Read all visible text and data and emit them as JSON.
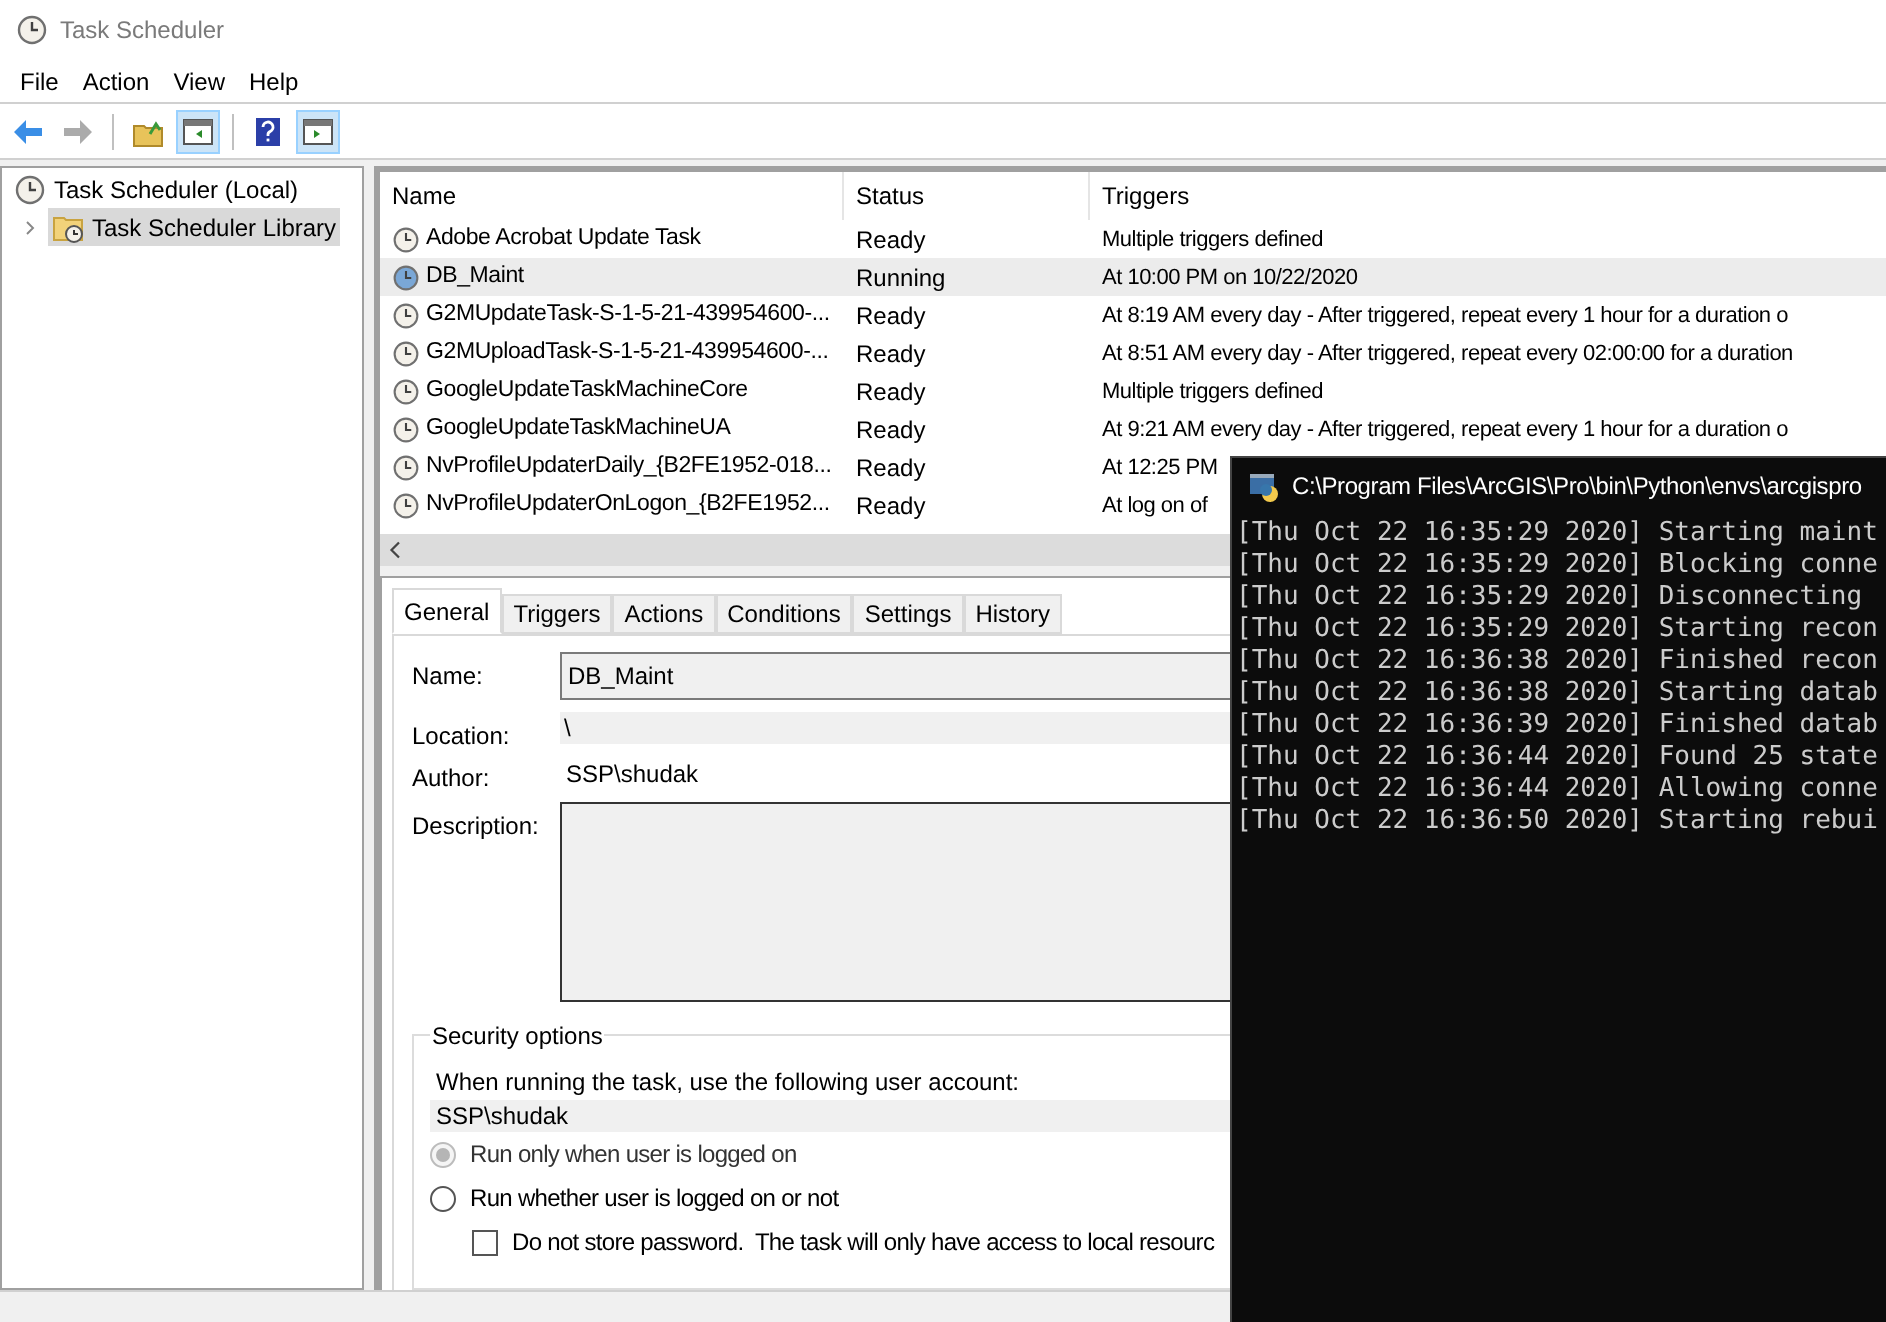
{
  "window": {
    "title": "Task Scheduler"
  },
  "menu": [
    "File",
    "Action",
    "View",
    "Help"
  ],
  "toolbar": [
    {
      "kind": "back",
      "disabled": false,
      "pressed": false
    },
    {
      "kind": "forward",
      "disabled": true,
      "pressed": false
    },
    {
      "kind": "up",
      "disabled": false,
      "pressed": false
    },
    {
      "kind": "tree",
      "disabled": false,
      "pressed": true
    },
    {
      "kind": "help",
      "disabled": false,
      "pressed": false
    },
    {
      "kind": "actions",
      "disabled": false,
      "pressed": true
    }
  ],
  "tree": [
    {
      "label": "Task Scheduler (Local)",
      "selected": false,
      "children": [
        {
          "label": "Task Scheduler Library",
          "selected": true,
          "expanded": false
        }
      ]
    }
  ],
  "table": {
    "columns": [
      "Name",
      "Status",
      "Triggers"
    ],
    "rows": [
      {
        "name": "Adobe Acrobat Update Task",
        "status": "Ready",
        "triggers": "Multiple triggers defined",
        "selected": false,
        "running": false
      },
      {
        "name": "DB_Maint",
        "status": "Running",
        "triggers": "At 10:00 PM on 10/22/2020",
        "selected": true,
        "running": true
      },
      {
        "name": "G2MUpdateTask-S-1-5-21-439954600-...",
        "status": "Ready",
        "triggers": "At 8:19 AM every day - After triggered, repeat every 1 hour for a duration o",
        "selected": false,
        "running": false
      },
      {
        "name": "G2MUploadTask-S-1-5-21-439954600-...",
        "status": "Ready",
        "triggers": "At 8:51 AM every day - After triggered, repeat every 02:00:00 for a duration",
        "selected": false,
        "running": false
      },
      {
        "name": "GoogleUpdateTaskMachineCore",
        "status": "Ready",
        "triggers": "Multiple triggers defined",
        "selected": false,
        "running": false
      },
      {
        "name": "GoogleUpdateTaskMachineUA",
        "status": "Ready",
        "triggers": "At 9:21 AM every day - After triggered, repeat every 1 hour for a duration o",
        "selected": false,
        "running": false
      },
      {
        "name": "NvProfileUpdaterDaily_{B2FE1952-018...",
        "status": "Ready",
        "triggers": "At 12:25 PM",
        "selected": false,
        "running": false
      },
      {
        "name": "NvProfileUpdaterOnLogon_{B2FE1952...",
        "status": "Ready",
        "triggers": "At log on of",
        "selected": false,
        "running": false
      }
    ]
  },
  "tabs": [
    {
      "label": "General",
      "selected": true
    },
    {
      "label": "Triggers",
      "selected": false
    },
    {
      "label": "Actions",
      "selected": false
    },
    {
      "label": "Conditions",
      "selected": false
    },
    {
      "label": "Settings",
      "selected": false
    },
    {
      "label": "History",
      "selected": false
    }
  ],
  "general": {
    "name_label": "Name:",
    "name": "DB_Maint",
    "location_label": "Location:",
    "location": "\\",
    "author_label": "Author:",
    "author": "SSP\\shudak",
    "description_label": "Description:"
  },
  "security": {
    "title": "Security options",
    "account_label": "When running the task, use the following user account:",
    "account": "SSP\\shudak",
    "options": [
      {
        "kind": "radio",
        "label": "Run only when user is logged on",
        "checked": true,
        "disabled": true
      },
      {
        "kind": "radio",
        "label": "Run whether user is logged on or not",
        "checked": false,
        "disabled": false
      },
      {
        "kind": "checkbox",
        "label": "Do not store password.  The task will only have access to local resourc",
        "checked": false,
        "disabled": false
      }
    ]
  },
  "console": {
    "title": "C:\\Program Files\\ArcGIS\\Pro\\bin\\Python\\envs\\arcgispro",
    "lines": [
      "[Thu Oct 22 16:35:29 2020] Starting maint",
      "[Thu Oct 22 16:35:29 2020] Blocking conne",
      "[Thu Oct 22 16:35:29 2020] Disconnecting",
      "[Thu Oct 22 16:35:29 2020] Starting recon",
      "[Thu Oct 22 16:36:38 2020] Finished recon",
      "[Thu Oct 22 16:36:38 2020] Starting datab",
      "[Thu Oct 22 16:36:39 2020] Finished datab",
      "[Thu Oct 22 16:36:44 2020] Found 25 state",
      "[Thu Oct 22 16:36:44 2020] Allowing conne",
      "[Thu Oct 22 16:36:50 2020] Starting rebui"
    ]
  }
}
